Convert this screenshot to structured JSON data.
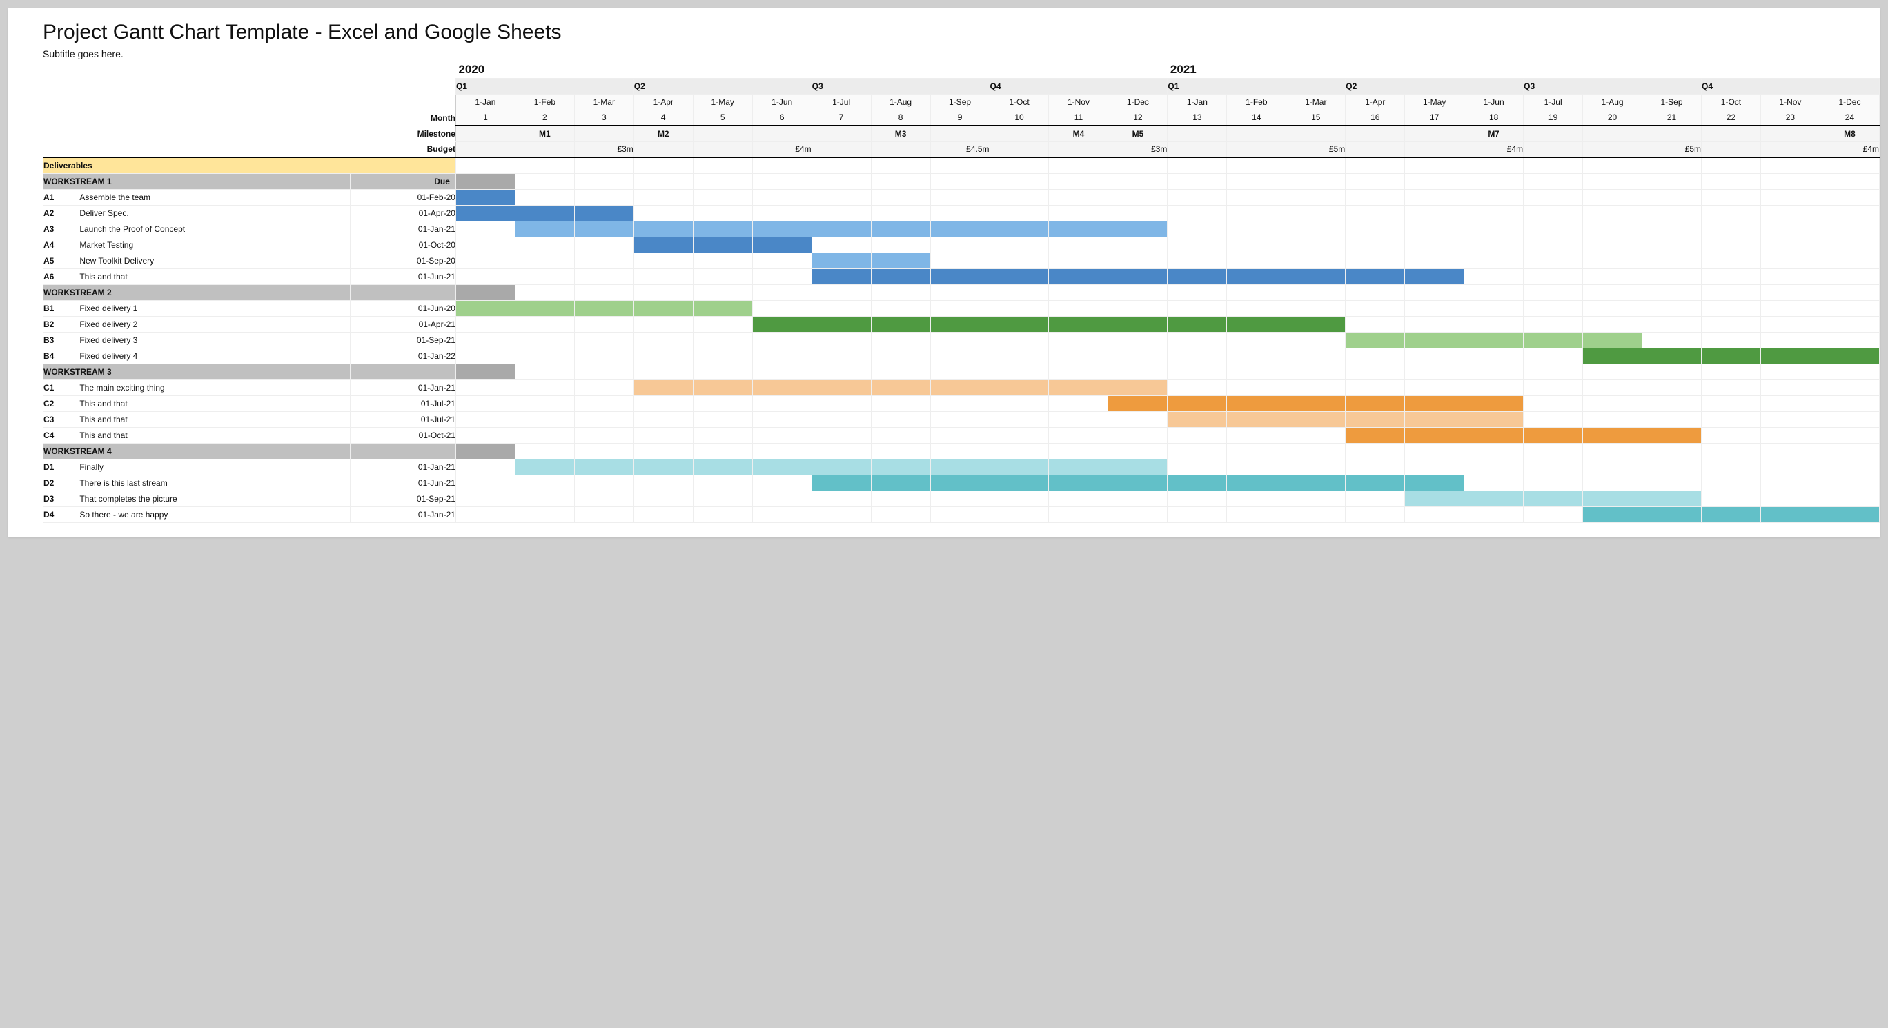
{
  "title": "Project Gantt Chart Template - Excel and Google Sheets",
  "subtitle": "Subtitle goes here.",
  "years": [
    "2020",
    "2021"
  ],
  "header": {
    "month_label": "Month",
    "milestone_label": "Milestone",
    "budget_label": "Budget",
    "deliverables_label": "Deliverables",
    "due_label": "Due",
    "quarters": [
      "Q1",
      "Q2",
      "Q3",
      "Q4",
      "Q1",
      "Q2",
      "Q3",
      "Q4"
    ],
    "months": [
      "1-Jan",
      "1-Feb",
      "1-Mar",
      "1-Apr",
      "1-May",
      "1-Jun",
      "1-Jul",
      "1-Aug",
      "1-Sep",
      "1-Oct",
      "1-Nov",
      "1-Dec",
      "1-Jan",
      "1-Feb",
      "1-Mar",
      "1-Apr",
      "1-May",
      "1-Jun",
      "1-Jul",
      "1-Aug",
      "1-Sep",
      "1-Oct",
      "1-Nov",
      "1-Dec"
    ],
    "month_nums": [
      "1",
      "2",
      "3",
      "4",
      "5",
      "6",
      "7",
      "8",
      "9",
      "10",
      "11",
      "12",
      "13",
      "14",
      "15",
      "16",
      "17",
      "18",
      "19",
      "20",
      "21",
      "22",
      "23",
      "24"
    ]
  },
  "milestones": {
    "2": "M1",
    "4": "M2",
    "8": "M3",
    "11": "M4",
    "12": "M5",
    "18": "M7",
    "24": "M8"
  },
  "budgets": {
    "3": "£3m",
    "6": "£4m",
    "9": "£4.5m",
    "12": "£3m",
    "15": "£5m",
    "18": "£4m",
    "21": "£5m",
    "24": "£4m"
  },
  "workstreams": [
    {
      "name": "WORKSTREAM 1",
      "color": "b1",
      "rows": [
        {
          "id": "A1",
          "task": "Assemble the team",
          "due": "01-Feb-20",
          "start": 1,
          "end": 1,
          "strong": true
        },
        {
          "id": "A2",
          "task": "Deliver Spec.",
          "due": "01-Apr-20",
          "start": 1,
          "end": 3,
          "strong": true
        },
        {
          "id": "A3",
          "task": "Launch the Proof of Concept",
          "due": "01-Jan-21",
          "start": 2,
          "end": 12,
          "strong": false
        },
        {
          "id": "A4",
          "task": "Market Testing",
          "due": "01-Oct-20",
          "start": 4,
          "end": 6,
          "strong": true
        },
        {
          "id": "A5",
          "task": "New Toolkit Delivery",
          "due": "01-Sep-20",
          "start": 7,
          "end": 8,
          "strong": false
        },
        {
          "id": "A6",
          "task": "This and that",
          "due": "01-Jun-21",
          "start": 7,
          "end": 17,
          "strong": true
        }
      ]
    },
    {
      "name": "WORKSTREAM 2",
      "color": "g1",
      "rows": [
        {
          "id": "B1",
          "task": "Fixed delivery 1",
          "due": "01-Jun-20",
          "start": 1,
          "end": 5,
          "strong": false
        },
        {
          "id": "B2",
          "task": "Fixed delivery 2",
          "due": "01-Apr-21",
          "start": 6,
          "end": 15,
          "strong": true
        },
        {
          "id": "B3",
          "task": "Fixed delivery 3",
          "due": "01-Sep-21",
          "start": 16,
          "end": 20,
          "strong": false
        },
        {
          "id": "B4",
          "task": "Fixed delivery 4",
          "due": "01-Jan-22",
          "start": 20,
          "end": 24,
          "strong": true
        }
      ]
    },
    {
      "name": "WORKSTREAM 3",
      "color": "o1",
      "rows": [
        {
          "id": "C1",
          "task": "The main exciting thing",
          "due": "01-Jan-21",
          "start": 4,
          "end": 12,
          "strong": false
        },
        {
          "id": "C2",
          "task": "This and that",
          "due": "01-Jul-21",
          "start": 12,
          "end": 18,
          "strong": true
        },
        {
          "id": "C3",
          "task": "This and that",
          "due": "01-Jul-21",
          "start": 13,
          "end": 18,
          "strong": false
        },
        {
          "id": "C4",
          "task": "This and that",
          "due": "01-Oct-21",
          "start": 16,
          "end": 21,
          "strong": true
        }
      ]
    },
    {
      "name": "WORKSTREAM 4",
      "color": "t1",
      "rows": [
        {
          "id": "D1",
          "task": "Finally",
          "due": "01-Jan-21",
          "start": 2,
          "end": 12,
          "strong": false
        },
        {
          "id": "D2",
          "task": "There is this last stream",
          "due": "01-Jun-21",
          "start": 7,
          "end": 17,
          "strong": true
        },
        {
          "id": "D3",
          "task": "That completes the picture",
          "due": "01-Sep-21",
          "start": 17,
          "end": 21,
          "strong": false
        },
        {
          "id": "D4",
          "task": "So there - we are happy",
          "due": "01-Jan-21",
          "start": 20,
          "end": 24,
          "strong": true
        }
      ]
    }
  ],
  "chart_data": {
    "type": "gantt",
    "title": "Project Gantt Chart Template - Excel and Google Sheets",
    "xlabel": "Month",
    "ylabel": "Deliverables",
    "x_categories": [
      "Jan-2020",
      "Feb-2020",
      "Mar-2020",
      "Apr-2020",
      "May-2020",
      "Jun-2020",
      "Jul-2020",
      "Aug-2020",
      "Sep-2020",
      "Oct-2020",
      "Nov-2020",
      "Dec-2020",
      "Jan-2021",
      "Feb-2021",
      "Mar-2021",
      "Apr-2021",
      "May-2021",
      "Jun-2021",
      "Jul-2021",
      "Aug-2021",
      "Sep-2021",
      "Oct-2021",
      "Nov-2021",
      "Dec-2021"
    ],
    "milestones": [
      {
        "month": 2,
        "label": "M1"
      },
      {
        "month": 4,
        "label": "M2"
      },
      {
        "month": 8,
        "label": "M3"
      },
      {
        "month": 11,
        "label": "M4"
      },
      {
        "month": 12,
        "label": "M5"
      },
      {
        "month": 18,
        "label": "M7"
      },
      {
        "month": 24,
        "label": "M8"
      }
    ],
    "budgets": [
      {
        "month": 3,
        "value": "£3m"
      },
      {
        "month": 6,
        "value": "£4m"
      },
      {
        "month": 9,
        "value": "£4.5m"
      },
      {
        "month": 12,
        "value": "£3m"
      },
      {
        "month": 15,
        "value": "£5m"
      },
      {
        "month": 18,
        "value": "£4m"
      },
      {
        "month": 21,
        "value": "£5m"
      },
      {
        "month": 24,
        "value": "£4m"
      }
    ],
    "series": [
      {
        "name": "WORKSTREAM 1",
        "color": "#4a87c7",
        "tasks": [
          {
            "id": "A1",
            "name": "Assemble the team",
            "due": "01-Feb-20",
            "start": 1,
            "end": 1
          },
          {
            "id": "A2",
            "name": "Deliver Spec.",
            "due": "01-Apr-20",
            "start": 1,
            "end": 3
          },
          {
            "id": "A3",
            "name": "Launch the Proof of Concept",
            "due": "01-Jan-21",
            "start": 2,
            "end": 12
          },
          {
            "id": "A4",
            "name": "Market Testing",
            "due": "01-Oct-20",
            "start": 4,
            "end": 6
          },
          {
            "id": "A5",
            "name": "New Toolkit Delivery",
            "due": "01-Sep-20",
            "start": 7,
            "end": 8
          },
          {
            "id": "A6",
            "name": "This and that",
            "due": "01-Jun-21",
            "start": 7,
            "end": 17
          }
        ]
      },
      {
        "name": "WORKSTREAM 2",
        "color": "#4f9a41",
        "tasks": [
          {
            "id": "B1",
            "name": "Fixed delivery 1",
            "due": "01-Jun-20",
            "start": 1,
            "end": 5
          },
          {
            "id": "B2",
            "name": "Fixed delivery 2",
            "due": "01-Apr-21",
            "start": 6,
            "end": 15
          },
          {
            "id": "B3",
            "name": "Fixed delivery 3",
            "due": "01-Sep-21",
            "start": 16,
            "end": 20
          },
          {
            "id": "B4",
            "name": "Fixed delivery 4",
            "due": "01-Jan-22",
            "start": 20,
            "end": 24
          }
        ]
      },
      {
        "name": "WORKSTREAM 3",
        "color": "#ee9b3e",
        "tasks": [
          {
            "id": "C1",
            "name": "The main exciting thing",
            "due": "01-Jan-21",
            "start": 4,
            "end": 12
          },
          {
            "id": "C2",
            "name": "This and that",
            "due": "01-Jul-21",
            "start": 12,
            "end": 18
          },
          {
            "id": "C3",
            "name": "This and that",
            "due": "01-Jul-21",
            "start": 13,
            "end": 18
          },
          {
            "id": "C4",
            "name": "This and that",
            "due": "01-Oct-21",
            "start": 16,
            "end": 21
          }
        ]
      },
      {
        "name": "WORKSTREAM 4",
        "color": "#62c0c8",
        "tasks": [
          {
            "id": "D1",
            "name": "Finally",
            "due": "01-Jan-21",
            "start": 2,
            "end": 12
          },
          {
            "id": "D2",
            "name": "There is this last stream",
            "due": "01-Jun-21",
            "start": 7,
            "end": 17
          },
          {
            "id": "D3",
            "name": "That completes the picture",
            "due": "01-Sep-21",
            "start": 17,
            "end": 21
          },
          {
            "id": "D4",
            "name": "So there - we are happy",
            "due": "01-Jan-21",
            "start": 20,
            "end": 24
          }
        ]
      }
    ]
  }
}
